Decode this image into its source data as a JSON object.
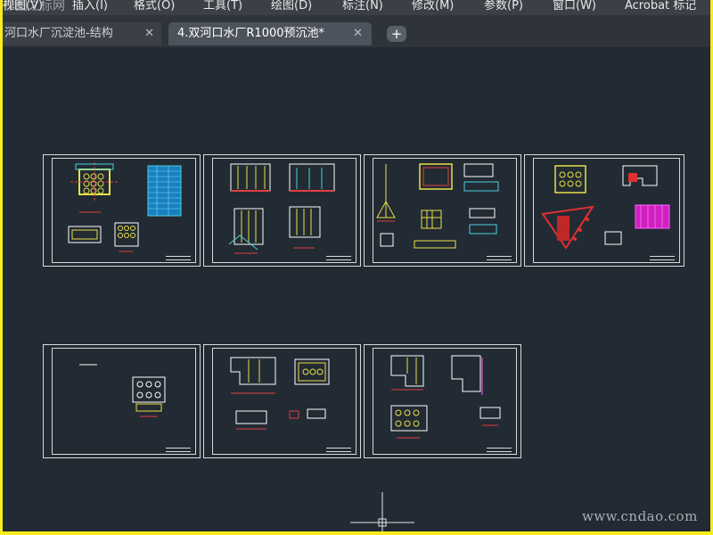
{
  "watermark": "作图之标网",
  "menu": {
    "items": [
      {
        "label": "视图(V)"
      },
      {
        "label": "插入(I)"
      },
      {
        "label": "格式(O)"
      },
      {
        "label": "工具(T)"
      },
      {
        "label": "绘图(D)"
      },
      {
        "label": "标注(N)"
      },
      {
        "label": "修改(M)"
      },
      {
        "label": "参数(P)"
      },
      {
        "label": "窗口(W)"
      },
      {
        "label": "Acrobat 标记"
      }
    ]
  },
  "tabs": [
    {
      "label": "河口水厂沉淀池-结构",
      "active": false
    },
    {
      "label": "4.双河口水厂R1000预沉池*",
      "active": true
    }
  ],
  "new_tab_label": "+",
  "close_glyph": "✕",
  "canvas": {
    "sheet_count": 7
  },
  "site_watermark": "www.cndao.com",
  "colors": {
    "background": "#232a34",
    "frame_accent": "#f7ec1d",
    "menubar": "#3b3f46",
    "active_tab": "#4d535c"
  }
}
